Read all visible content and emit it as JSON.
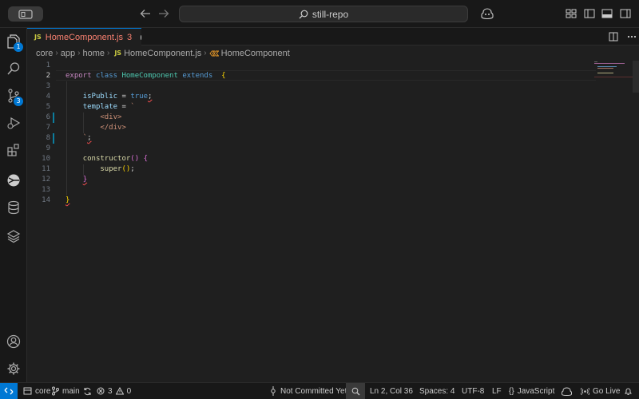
{
  "titlebar": {
    "search_text": "still-repo"
  },
  "activity": {
    "explorer_badge": "1",
    "scm_badge": "3"
  },
  "tab": {
    "file_badge": "JS",
    "file_name": "HomeComponent.js",
    "problem_count": "3"
  },
  "breadcrumb": {
    "parts": [
      "core",
      "app",
      "home",
      "HomeComponent.js",
      "HomeComponent"
    ],
    "file_badge": "JS"
  },
  "editor": {
    "line_numbers": [
      "1",
      "2",
      "3",
      "4",
      "5",
      "6",
      "7",
      "8",
      "9",
      "10",
      "11",
      "12",
      "13",
      "14"
    ],
    "active_line": "2"
  },
  "statusbar": {
    "folder": "core",
    "branch": "main",
    "errors": "3",
    "warnings": "0",
    "commit_status": "Not Committed Yet",
    "cursor": "Ln 2, Col 36",
    "spaces": "Spaces: 4",
    "encoding": "UTF-8",
    "eol": "LF",
    "language": "JavaScript",
    "go_live": "Go Live"
  },
  "colors": {
    "accent": "#0078d4",
    "error_tab": "#f88070",
    "background": "#1f1f1f"
  }
}
